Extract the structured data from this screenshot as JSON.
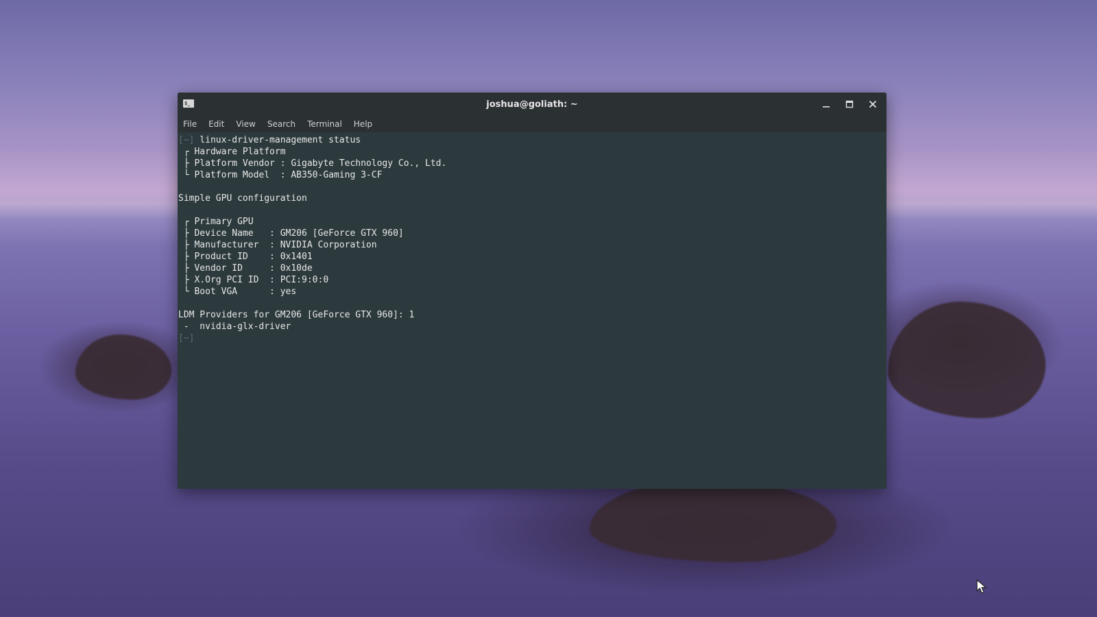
{
  "window": {
    "title": "joshua@goliath: ~",
    "icon": "terminal-icon"
  },
  "menu": [
    "File",
    "Edit",
    "View",
    "Search",
    "Terminal",
    "Help"
  ],
  "terminal": {
    "prompt": "[~]",
    "command": " linux-driver-management status",
    "lines": [
      " ┌ Hardware Platform",
      " ├ Platform Vendor : Gigabyte Technology Co., Ltd.",
      " └ Platform Model  : AB350-Gaming 3-CF",
      "",
      "Simple GPU configuration",
      "",
      " ┌ Primary GPU",
      " ├ Device Name   : GM206 [GeForce GTX 960]",
      " ├ Manufacturer  : NVIDIA Corporation",
      " ├ Product ID    : 0x1401",
      " ├ Vendor ID     : 0x10de",
      " ├ X.Org PCI ID  : PCI:9:0:0",
      " └ Boot VGA      : yes",
      "",
      "LDM Providers for GM206 [GeForce GTX 960]: 1",
      " -  nvidia-glx-driver"
    ]
  },
  "colors": {
    "terminal_bg": "#2d3a3d",
    "titlebar_bg": "#2b3033",
    "text": "#e8e8e8",
    "prompt": "#5f6b6e"
  }
}
